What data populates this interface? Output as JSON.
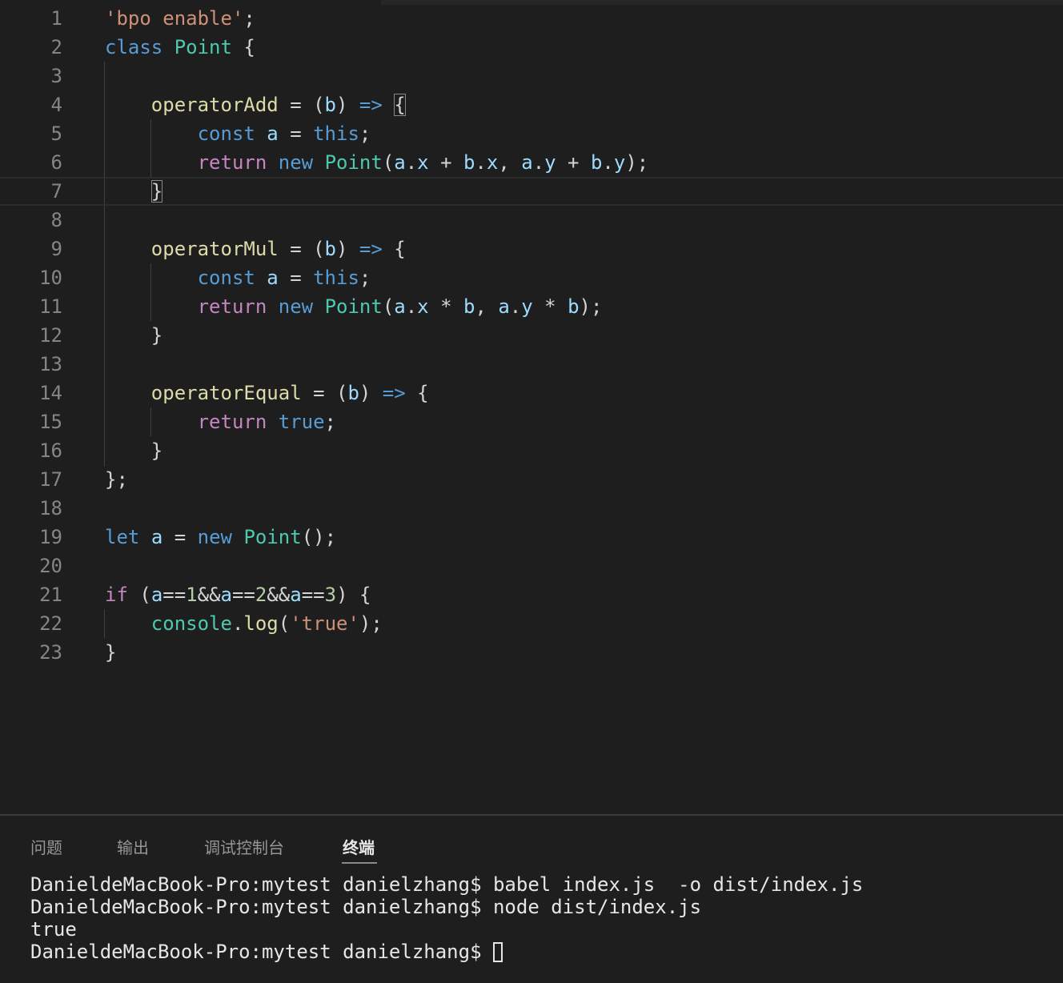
{
  "editor": {
    "lines": [
      {
        "num": "1",
        "tokens": [
          {
            "t": "'bpo enable'",
            "c": "str"
          },
          {
            "t": ";"
          }
        ]
      },
      {
        "num": "2",
        "tokens": [
          {
            "t": "class",
            "c": "kw"
          },
          {
            "t": " "
          },
          {
            "t": "Point",
            "c": "cls"
          },
          {
            "t": " {"
          }
        ]
      },
      {
        "num": "3",
        "tokens": []
      },
      {
        "num": "4",
        "tokens": [
          {
            "t": "    "
          },
          {
            "t": "operatorAdd",
            "c": "fn"
          },
          {
            "t": " = ("
          },
          {
            "t": "b",
            "c": "var"
          },
          {
            "t": ") "
          },
          {
            "t": "=>",
            "c": "kw"
          },
          {
            "t": " "
          },
          {
            "t": "{",
            "c": "br"
          }
        ]
      },
      {
        "num": "5",
        "tokens": [
          {
            "t": "        "
          },
          {
            "t": "const",
            "c": "kw"
          },
          {
            "t": " "
          },
          {
            "t": "a",
            "c": "var"
          },
          {
            "t": " = "
          },
          {
            "t": "this",
            "c": "kw"
          },
          {
            "t": ";"
          }
        ]
      },
      {
        "num": "6",
        "tokens": [
          {
            "t": "        "
          },
          {
            "t": "return",
            "c": "ctl"
          },
          {
            "t": " "
          },
          {
            "t": "new",
            "c": "kw"
          },
          {
            "t": " "
          },
          {
            "t": "Point",
            "c": "cls"
          },
          {
            "t": "("
          },
          {
            "t": "a",
            "c": "var"
          },
          {
            "t": "."
          },
          {
            "t": "x",
            "c": "var"
          },
          {
            "t": " + "
          },
          {
            "t": "b",
            "c": "var"
          },
          {
            "t": "."
          },
          {
            "t": "x",
            "c": "var"
          },
          {
            "t": ", "
          },
          {
            "t": "a",
            "c": "var"
          },
          {
            "t": "."
          },
          {
            "t": "y",
            "c": "var"
          },
          {
            "t": " + "
          },
          {
            "t": "b",
            "c": "var"
          },
          {
            "t": "."
          },
          {
            "t": "y",
            "c": "var"
          },
          {
            "t": ");"
          }
        ]
      },
      {
        "num": "7",
        "tokens": [
          {
            "t": "    "
          },
          {
            "t": "}",
            "c": "br"
          }
        ],
        "current": true
      },
      {
        "num": "8",
        "tokens": []
      },
      {
        "num": "9",
        "tokens": [
          {
            "t": "    "
          },
          {
            "t": "operatorMul",
            "c": "fn"
          },
          {
            "t": " = ("
          },
          {
            "t": "b",
            "c": "var"
          },
          {
            "t": ") "
          },
          {
            "t": "=>",
            "c": "kw"
          },
          {
            "t": " {"
          }
        ]
      },
      {
        "num": "10",
        "tokens": [
          {
            "t": "        "
          },
          {
            "t": "const",
            "c": "kw"
          },
          {
            "t": " "
          },
          {
            "t": "a",
            "c": "var"
          },
          {
            "t": " = "
          },
          {
            "t": "this",
            "c": "kw"
          },
          {
            "t": ";"
          }
        ]
      },
      {
        "num": "11",
        "tokens": [
          {
            "t": "        "
          },
          {
            "t": "return",
            "c": "ctl"
          },
          {
            "t": " "
          },
          {
            "t": "new",
            "c": "kw"
          },
          {
            "t": " "
          },
          {
            "t": "Point",
            "c": "cls"
          },
          {
            "t": "("
          },
          {
            "t": "a",
            "c": "var"
          },
          {
            "t": "."
          },
          {
            "t": "x",
            "c": "var"
          },
          {
            "t": " * "
          },
          {
            "t": "b",
            "c": "var"
          },
          {
            "t": ", "
          },
          {
            "t": "a",
            "c": "var"
          },
          {
            "t": "."
          },
          {
            "t": "y",
            "c": "var"
          },
          {
            "t": " * "
          },
          {
            "t": "b",
            "c": "var"
          },
          {
            "t": ");"
          }
        ]
      },
      {
        "num": "12",
        "tokens": [
          {
            "t": "    }"
          }
        ]
      },
      {
        "num": "13",
        "tokens": []
      },
      {
        "num": "14",
        "tokens": [
          {
            "t": "    "
          },
          {
            "t": "operatorEqual",
            "c": "fn"
          },
          {
            "t": " = ("
          },
          {
            "t": "b",
            "c": "var"
          },
          {
            "t": ") "
          },
          {
            "t": "=>",
            "c": "kw"
          },
          {
            "t": " {"
          }
        ]
      },
      {
        "num": "15",
        "tokens": [
          {
            "t": "        "
          },
          {
            "t": "return",
            "c": "ctl"
          },
          {
            "t": " "
          },
          {
            "t": "true",
            "c": "kw"
          },
          {
            "t": ";"
          }
        ]
      },
      {
        "num": "16",
        "tokens": [
          {
            "t": "    }"
          }
        ]
      },
      {
        "num": "17",
        "tokens": [
          {
            "t": "};"
          }
        ]
      },
      {
        "num": "18",
        "tokens": []
      },
      {
        "num": "19",
        "tokens": [
          {
            "t": "let",
            "c": "kw"
          },
          {
            "t": " "
          },
          {
            "t": "a",
            "c": "var"
          },
          {
            "t": " = "
          },
          {
            "t": "new",
            "c": "kw"
          },
          {
            "t": " "
          },
          {
            "t": "Point",
            "c": "cls"
          },
          {
            "t": "();"
          }
        ]
      },
      {
        "num": "20",
        "tokens": []
      },
      {
        "num": "21",
        "tokens": [
          {
            "t": "if",
            "c": "ctl"
          },
          {
            "t": " ("
          },
          {
            "t": "a",
            "c": "var"
          },
          {
            "t": "=="
          },
          {
            "t": "1",
            "c": "num"
          },
          {
            "t": "&&"
          },
          {
            "t": "a",
            "c": "var"
          },
          {
            "t": "=="
          },
          {
            "t": "2",
            "c": "num"
          },
          {
            "t": "&&"
          },
          {
            "t": "a",
            "c": "var"
          },
          {
            "t": "=="
          },
          {
            "t": "3",
            "c": "num"
          },
          {
            "t": ") {"
          }
        ]
      },
      {
        "num": "22",
        "tokens": [
          {
            "t": "    "
          },
          {
            "t": "console",
            "c": "cls"
          },
          {
            "t": "."
          },
          {
            "t": "log",
            "c": "fn"
          },
          {
            "t": "("
          },
          {
            "t": "'true'",
            "c": "str"
          },
          {
            "t": ");"
          }
        ]
      },
      {
        "num": "23",
        "tokens": [
          {
            "t": "}"
          }
        ]
      }
    ]
  },
  "panel": {
    "tabs": [
      {
        "label": "问题",
        "name": "tab-problems",
        "active": false
      },
      {
        "label": "输出",
        "name": "tab-output",
        "active": false
      },
      {
        "label": "调试控制台",
        "name": "tab-debug-console",
        "active": false
      },
      {
        "label": "终端",
        "name": "tab-terminal",
        "active": true
      }
    ],
    "terminal": {
      "lines": [
        "DanieldeMacBook-Pro:mytest danielzhang$ babel index.js  -o dist/index.js",
        "DanieldeMacBook-Pro:mytest danielzhang$ node dist/index.js",
        "true",
        "DanieldeMacBook-Pro:mytest danielzhang$ "
      ]
    }
  },
  "colors": {
    "background": "#1e1e1e",
    "keyword": "#569cd6",
    "control": "#c586c0",
    "string": "#ce9178",
    "class": "#4ec9b0",
    "function": "#dcdcaa",
    "variable": "#9cdcfe",
    "number": "#b5cea8"
  }
}
